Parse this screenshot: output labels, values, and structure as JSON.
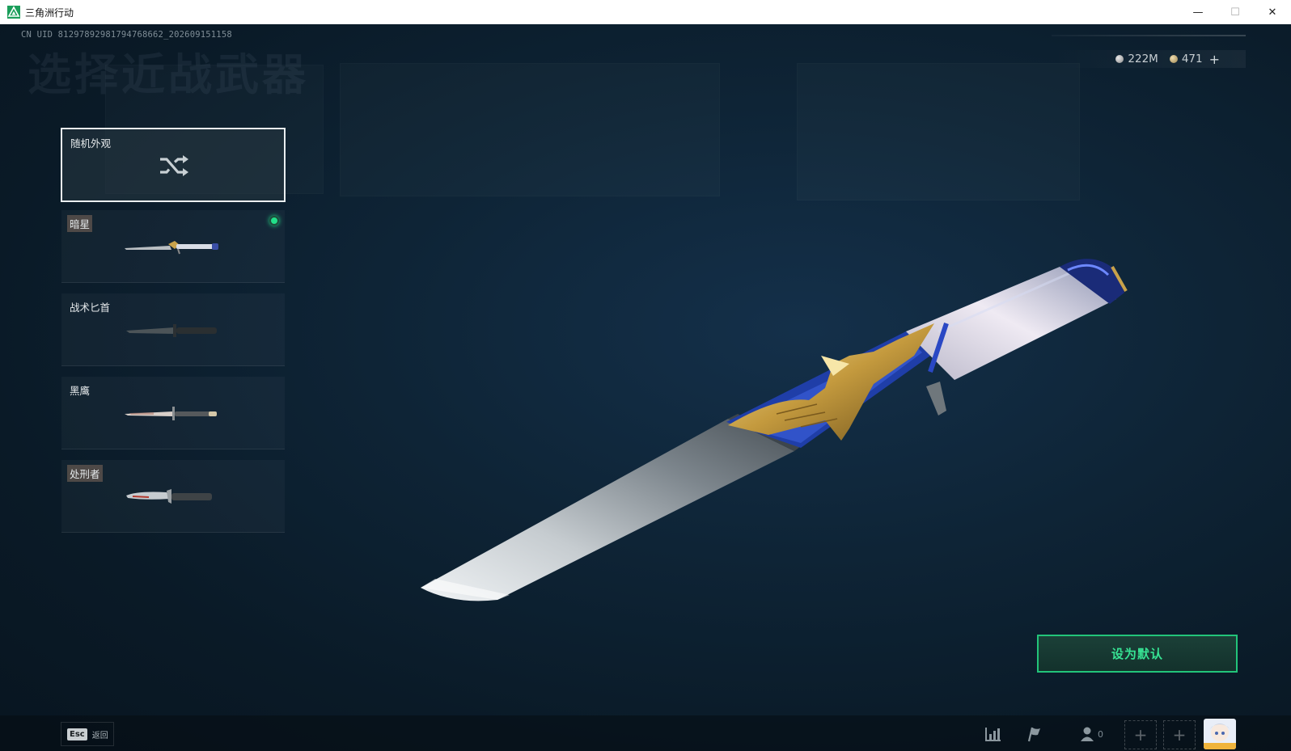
{
  "window": {
    "title": "三角洲行动",
    "controls": [
      "minimize-icon",
      "maximize-icon",
      "close-icon"
    ]
  },
  "header": {
    "uid": "CN UID 8129789298179476866​2_202609151158",
    "page_title": "选择近战武器"
  },
  "currency": [
    {
      "icon": "silver-coin-icon",
      "value": "222M"
    },
    {
      "icon": "gold-coin-icon",
      "value": "471"
    }
  ],
  "skins": [
    {
      "label": "随机外观",
      "kind": "random",
      "icon": "shuffle-icon",
      "selected": true
    },
    {
      "label": "暗星",
      "kind": "skin",
      "tag": true,
      "equipped": true
    },
    {
      "label": "战术匕首",
      "kind": "skin",
      "tag": false,
      "equipped": false
    },
    {
      "label": "黑鹰",
      "kind": "skin",
      "tag": false,
      "equipped": false
    },
    {
      "label": "处刑者",
      "kind": "skin",
      "tag": true,
      "equipped": false
    }
  ],
  "actions": {
    "set_default": "设为默认"
  },
  "bottom_bar": {
    "esc_key": "Esc",
    "back_label": "返回",
    "friend_count": "0"
  },
  "colors": {
    "accent_green": "#22c47a",
    "equipped_dot": "#22e08a",
    "background": "#0b1a25"
  }
}
